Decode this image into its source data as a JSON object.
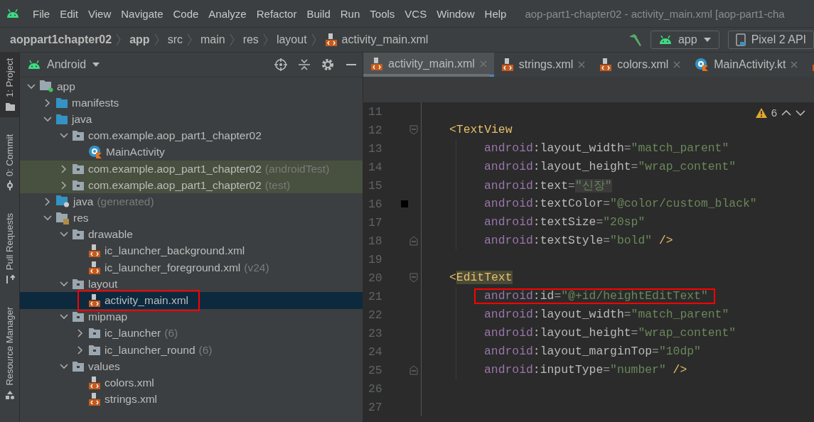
{
  "menu": {
    "items": [
      "File",
      "Edit",
      "View",
      "Navigate",
      "Code",
      "Analyze",
      "Refactor",
      "Build",
      "Run",
      "Tools",
      "VCS",
      "Window",
      "Help"
    ],
    "title": "aop-part1-chapter02 - activity_main.xml [aop-part1-cha"
  },
  "navbar": {
    "crumbs": [
      {
        "label": "aoppart1chapter02",
        "bold": true
      },
      {
        "label": "app",
        "bold": true
      },
      {
        "label": "src",
        "bold": false
      },
      {
        "label": "main",
        "bold": false
      },
      {
        "label": "res",
        "bold": false
      },
      {
        "label": "layout",
        "bold": false
      },
      {
        "label": "activity_main.xml",
        "bold": false
      }
    ],
    "run_config": "app",
    "device": "Pixel 2 API"
  },
  "toolstrip": [
    {
      "label": "1: Project",
      "selected": true
    },
    {
      "label": "0: Commit",
      "selected": false
    },
    {
      "label": "Pull Requests",
      "selected": false
    },
    {
      "label": "Resource Manager",
      "selected": false
    }
  ],
  "project": {
    "view": "Android",
    "tree": [
      {
        "label": "app",
        "kind": "module",
        "expanded": true,
        "selected": false,
        "tinted": false,
        "boxed": false,
        "children": [
          {
            "label": "manifests",
            "kind": "folder",
            "expanded": false,
            "selected": false,
            "tinted": false,
            "boxed": false
          },
          {
            "label": "java",
            "kind": "folder",
            "expanded": true,
            "selected": false,
            "tinted": false,
            "boxed": false,
            "children": [
              {
                "label": "com.example.aop_part1_chapter02",
                "kind": "package",
                "expanded": true,
                "selected": false,
                "tinted": false,
                "boxed": false,
                "children": [
                  {
                    "label": "MainActivity",
                    "kind": "kotlin",
                    "selected": false,
                    "tinted": false,
                    "boxed": false
                  }
                ]
              },
              {
                "label": "com.example.aop_part1_chapter02",
                "suffix": "(androidTest)",
                "kind": "package",
                "expanded": false,
                "selected": false,
                "tinted": true,
                "boxed": false
              },
              {
                "label": "com.example.aop_part1_chapter02",
                "suffix": "(test)",
                "kind": "package",
                "expanded": false,
                "selected": false,
                "tinted": true,
                "boxed": false
              }
            ]
          },
          {
            "label": "java",
            "suffix": "(generated)",
            "kind": "generated",
            "expanded": false,
            "selected": false,
            "tinted": false,
            "boxed": false
          },
          {
            "label": "res",
            "kind": "res",
            "expanded": true,
            "selected": false,
            "tinted": false,
            "boxed": false,
            "children": [
              {
                "label": "drawable",
                "kind": "package",
                "expanded": true,
                "selected": false,
                "tinted": false,
                "boxed": false,
                "children": [
                  {
                    "label": "ic_launcher_background.xml",
                    "kind": "xml",
                    "selected": false,
                    "tinted": false,
                    "boxed": false
                  },
                  {
                    "label": "ic_launcher_foreground.xml",
                    "suffix": "(v24)",
                    "kind": "xml",
                    "selected": false,
                    "tinted": false,
                    "boxed": false
                  }
                ]
              },
              {
                "label": "layout",
                "kind": "package",
                "expanded": true,
                "selected": false,
                "tinted": false,
                "boxed": false,
                "children": [
                  {
                    "label": "activity_main.xml",
                    "kind": "xml",
                    "selected": true,
                    "tinted": false,
                    "boxed": true
                  }
                ]
              },
              {
                "label": "mipmap",
                "kind": "package",
                "expanded": true,
                "selected": false,
                "tinted": false,
                "boxed": false,
                "children": [
                  {
                    "label": "ic_launcher",
                    "suffix": "(6)",
                    "kind": "package",
                    "expanded": false,
                    "selected": false,
                    "tinted": false,
                    "boxed": false
                  },
                  {
                    "label": "ic_launcher_round",
                    "suffix": "(6)",
                    "kind": "package",
                    "expanded": false,
                    "selected": false,
                    "tinted": false,
                    "boxed": false
                  }
                ]
              },
              {
                "label": "values",
                "kind": "package",
                "expanded": true,
                "selected": false,
                "tinted": false,
                "boxed": false,
                "children": [
                  {
                    "label": "colors.xml",
                    "kind": "xml",
                    "selected": false,
                    "tinted": false,
                    "boxed": false
                  },
                  {
                    "label": "strings.xml",
                    "kind": "xml",
                    "selected": false,
                    "tinted": false,
                    "boxed": false
                  }
                ]
              }
            ]
          }
        ]
      }
    ]
  },
  "editor": {
    "tabs": [
      {
        "label": "activity_main.xml",
        "kind": "xml",
        "selected": true
      },
      {
        "label": "strings.xml",
        "kind": "xml",
        "selected": false
      },
      {
        "label": "colors.xml",
        "kind": "xml",
        "selected": false
      },
      {
        "label": "MainActivity.kt",
        "kind": "kotlin",
        "selected": false
      }
    ],
    "warnings": "6",
    "lines": [
      {
        "number": "11",
        "kind": "blank",
        "fold_start": false,
        "fold_end": false,
        "boxed": false
      },
      {
        "number": "12",
        "kind": "tag",
        "fold_start": true,
        "fold_end": false,
        "boxed": false,
        "tokens": [
          {
            "kind": "punct",
            "text": "<",
            "highlight": false
          },
          {
            "kind": "tag",
            "text": "TextView",
            "highlight": false
          }
        ]
      },
      {
        "number": "13",
        "kind": "attr",
        "fold_start": false,
        "fold_end": false,
        "boxed": false,
        "tokens": [
          {
            "kind": "ns",
            "text": "android",
            "highlight": false
          },
          {
            "kind": "attr",
            "text": ":layout_width",
            "highlight": false
          },
          {
            "kind": "eq",
            "text": "=",
            "highlight": false
          },
          {
            "kind": "str",
            "text": "\"match_parent\"",
            "highlight": false
          }
        ]
      },
      {
        "number": "14",
        "kind": "attr",
        "fold_start": false,
        "fold_end": false,
        "boxed": false,
        "tokens": [
          {
            "kind": "ns",
            "text": "android",
            "highlight": false
          },
          {
            "kind": "attr",
            "text": ":layout_height",
            "highlight": false
          },
          {
            "kind": "eq",
            "text": "=",
            "highlight": false
          },
          {
            "kind": "str",
            "text": "\"wrap_content\"",
            "highlight": false
          }
        ]
      },
      {
        "number": "15",
        "kind": "attr",
        "fold_start": false,
        "fold_end": false,
        "boxed": false,
        "tokens": [
          {
            "kind": "ns",
            "text": "android",
            "highlight": false
          },
          {
            "kind": "attr",
            "text": ":text",
            "highlight": false
          },
          {
            "kind": "eq",
            "text": "=",
            "highlight": false
          },
          {
            "kind": "str",
            "text": "\"신장\"",
            "highlight": true
          }
        ]
      },
      {
        "number": "16",
        "kind": "attr",
        "fold_start": false,
        "fold_end": false,
        "boxed": false,
        "color": "#000000",
        "tokens": [
          {
            "kind": "ns",
            "text": "android",
            "highlight": false
          },
          {
            "kind": "attr",
            "text": ":textColor",
            "highlight": false
          },
          {
            "kind": "eq",
            "text": "=",
            "highlight": false
          },
          {
            "kind": "str",
            "text": "\"@color/custom_black\"",
            "highlight": false
          }
        ]
      },
      {
        "number": "17",
        "kind": "attr",
        "fold_start": false,
        "fold_end": false,
        "boxed": false,
        "tokens": [
          {
            "kind": "ns",
            "text": "android",
            "highlight": false
          },
          {
            "kind": "attr",
            "text": ":textSize",
            "highlight": false
          },
          {
            "kind": "eq",
            "text": "=",
            "highlight": false
          },
          {
            "kind": "str",
            "text": "\"20sp\"",
            "highlight": false
          }
        ]
      },
      {
        "number": "18",
        "kind": "attr",
        "fold_start": false,
        "fold_end": true,
        "boxed": false,
        "tokens": [
          {
            "kind": "ns",
            "text": "android",
            "highlight": false
          },
          {
            "kind": "attr",
            "text": ":textStyle",
            "highlight": false
          },
          {
            "kind": "eq",
            "text": "=",
            "highlight": false
          },
          {
            "kind": "str",
            "text": "\"bold\"",
            "highlight": false
          },
          {
            "kind": "punct",
            "text": " />",
            "highlight": false
          }
        ]
      },
      {
        "number": "19",
        "kind": "blank",
        "fold_start": false,
        "fold_end": false,
        "boxed": false
      },
      {
        "number": "20",
        "kind": "tag",
        "fold_start": true,
        "fold_end": false,
        "boxed": false,
        "tokens": [
          {
            "kind": "punct",
            "text": "<",
            "highlight": false
          },
          {
            "kind": "tag",
            "text": "EditText",
            "highlight": true
          }
        ]
      },
      {
        "number": "21",
        "kind": "attr",
        "fold_start": false,
        "fold_end": false,
        "boxed": true,
        "tokens": [
          {
            "kind": "ns",
            "text": "android",
            "highlight": false
          },
          {
            "kind": "attr",
            "text": ":id",
            "highlight": false
          },
          {
            "kind": "eq",
            "text": "=",
            "highlight": false
          },
          {
            "kind": "str",
            "text": "\"@+id/heightEditText\"",
            "highlight": false
          }
        ]
      },
      {
        "number": "22",
        "kind": "attr",
        "fold_start": false,
        "fold_end": false,
        "boxed": false,
        "tokens": [
          {
            "kind": "ns",
            "text": "android",
            "highlight": false
          },
          {
            "kind": "attr",
            "text": ":layout_width",
            "highlight": false
          },
          {
            "kind": "eq",
            "text": "=",
            "highlight": false
          },
          {
            "kind": "str",
            "text": "\"match_parent\"",
            "highlight": false
          }
        ]
      },
      {
        "number": "23",
        "kind": "attr",
        "fold_start": false,
        "fold_end": false,
        "boxed": false,
        "tokens": [
          {
            "kind": "ns",
            "text": "android",
            "highlight": false
          },
          {
            "kind": "attr",
            "text": ":layout_height",
            "highlight": false
          },
          {
            "kind": "eq",
            "text": "=",
            "highlight": false
          },
          {
            "kind": "str",
            "text": "\"wrap_content\"",
            "highlight": false
          }
        ]
      },
      {
        "number": "24",
        "kind": "attr",
        "fold_start": false,
        "fold_end": false,
        "boxed": false,
        "tokens": [
          {
            "kind": "ns",
            "text": "android",
            "highlight": false
          },
          {
            "kind": "attr",
            "text": ":layout_marginTop",
            "highlight": false
          },
          {
            "kind": "eq",
            "text": "=",
            "highlight": false
          },
          {
            "kind": "str",
            "text": "\"10dp\"",
            "highlight": false
          }
        ]
      },
      {
        "number": "25",
        "kind": "attr",
        "fold_start": false,
        "fold_end": true,
        "boxed": false,
        "tokens": [
          {
            "kind": "ns",
            "text": "android",
            "highlight": false
          },
          {
            "kind": "attr",
            "text": ":inputType",
            "highlight": false
          },
          {
            "kind": "eq",
            "text": "=",
            "highlight": false
          },
          {
            "kind": "str",
            "text": "\"number\"",
            "highlight": false
          },
          {
            "kind": "punct",
            "text": " />",
            "highlight": false
          }
        ]
      },
      {
        "number": "26",
        "kind": "blank",
        "fold_start": false,
        "fold_end": false,
        "boxed": false
      },
      {
        "number": "27",
        "kind": "blank",
        "fold_start": false,
        "fold_end": false,
        "boxed": false
      }
    ]
  }
}
